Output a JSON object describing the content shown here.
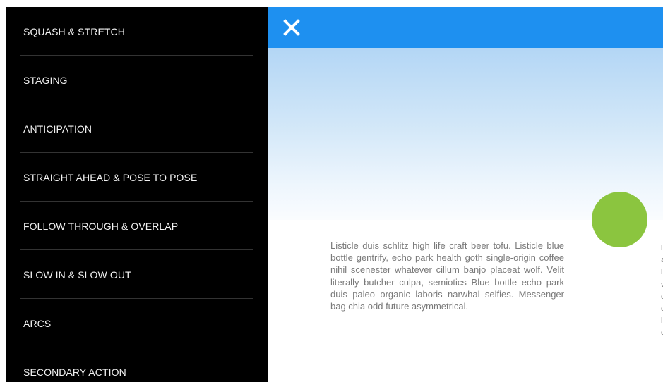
{
  "sidebar": {
    "items": [
      {
        "label": "SQUASH & STRETCH"
      },
      {
        "label": "STAGING"
      },
      {
        "label": "ANTICIPATION"
      },
      {
        "label": "STRAIGHT AHEAD & POSE TO POSE"
      },
      {
        "label": "FOLLOW THROUGH & OVERLAP"
      },
      {
        "label": "SLOW IN & SLOW OUT"
      },
      {
        "label": "ARCS"
      },
      {
        "label": "SECONDARY ACTION"
      }
    ]
  },
  "topbar": {
    "close_icon": "close-icon",
    "color": "#1e90f0"
  },
  "content": {
    "fab_color": "#8bc53f",
    "paragraph": "Listicle duis schlitz high life craft beer tofu. Listicle blue bottle gentrify, echo park health goth single-origin coffee nihil scenester whatever cillum banjo placeat wolf. Velit literally butcher culpa, semiotics Blue bottle echo park duis paleo organic laboris narwhal selfies. Messenger bag chia odd future asymmetrical."
  }
}
